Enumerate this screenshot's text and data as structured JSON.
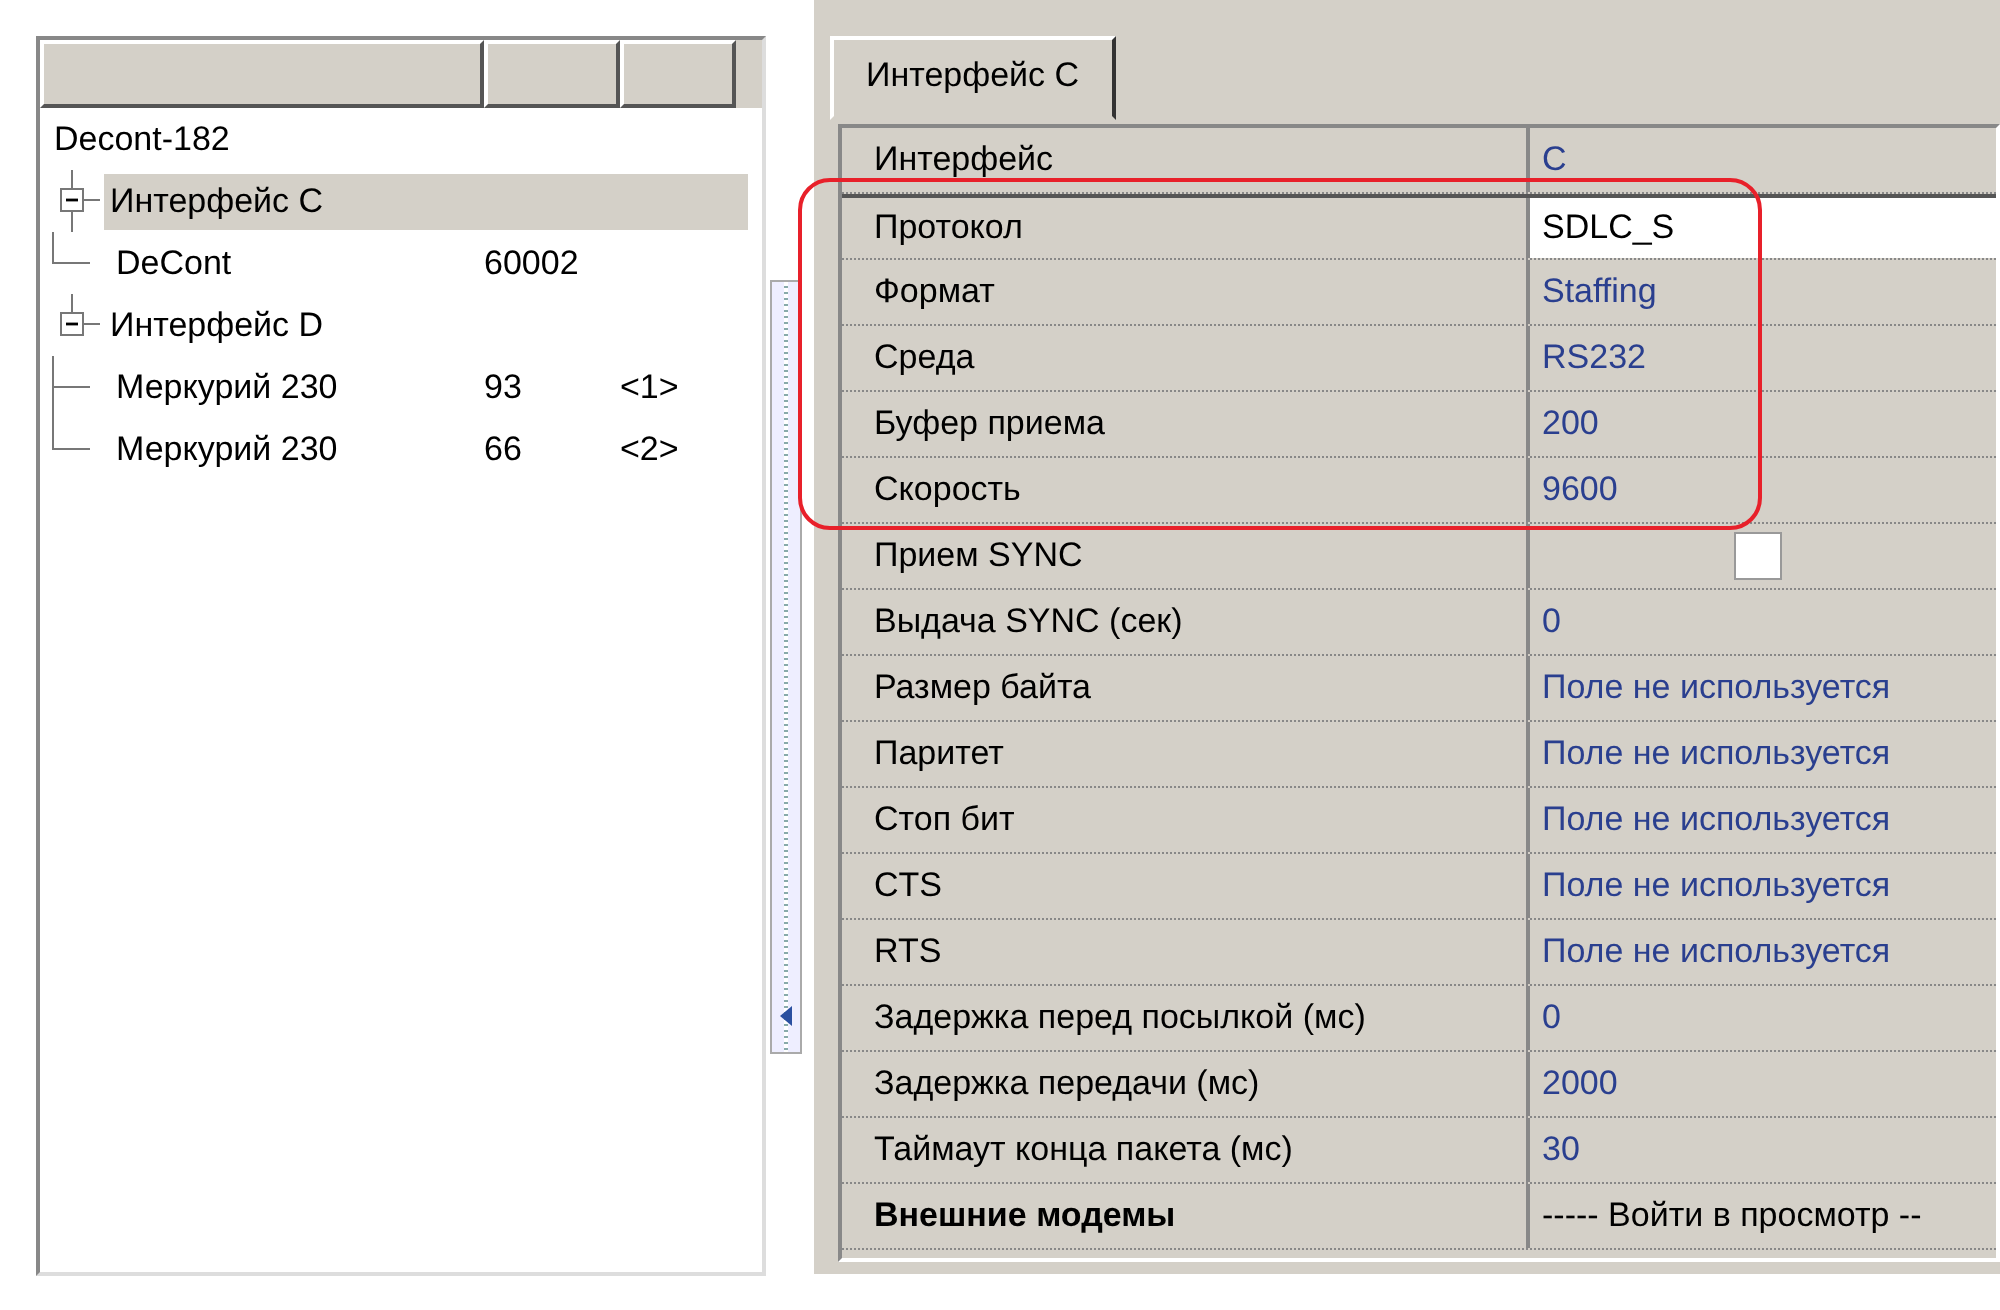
{
  "tree": {
    "root": {
      "label": "Decont-182",
      "children": [
        {
          "label": "Интерфейс C",
          "expanded": true,
          "selected": true,
          "children": [
            {
              "label": "DeCont",
              "column_2": "60002",
              "selected": false
            }
          ]
        },
        {
          "label": "Интерфейс D",
          "expanded": true,
          "selected": false,
          "children": [
            {
              "label": "Меркурий 230",
              "column_2": "93",
              "column_3": "<1>",
              "selected": false
            },
            {
              "label": "Меркурий 230",
              "column_2": "66",
              "column_3": "<2>",
              "selected": false
            }
          ]
        }
      ]
    }
  },
  "tabs": [
    {
      "label": "Интерфейс C",
      "selected": true
    }
  ],
  "properties": [
    {
      "name": "Интерфейс",
      "kind": "value",
      "value": "C",
      "selected": false
    },
    {
      "name": "Протокол",
      "kind": "value",
      "value": "SDLC_S",
      "selected": true
    },
    {
      "name": "Формат",
      "kind": "value",
      "value": "Staffing",
      "selected": false
    },
    {
      "name": "Среда",
      "kind": "value",
      "value": "RS232",
      "selected": false
    },
    {
      "name": "Буфер приема",
      "kind": "value",
      "value": "200",
      "selected": false
    },
    {
      "name": "Скорость",
      "kind": "value",
      "value": "9600",
      "selected": false
    },
    {
      "name": "Прием SYNC",
      "kind": "checkbox",
      "checked": false,
      "selected": false
    },
    {
      "name": "Выдача SYNC (сек)",
      "kind": "value",
      "value": "0",
      "selected": false
    },
    {
      "name": "Размер байта",
      "kind": "value",
      "value": "Поле не используется",
      "selected": false
    },
    {
      "name": "Паритет",
      "kind": "value",
      "value": "Поле не используется",
      "selected": false
    },
    {
      "name": "Стоп бит",
      "kind": "value",
      "value": "Поле не используется",
      "selected": false
    },
    {
      "name": "CTS",
      "kind": "value",
      "value": "Поле не используется",
      "selected": false
    },
    {
      "name": "RTS",
      "kind": "value",
      "value": "Поле не используется",
      "selected": false
    },
    {
      "name": "Задержка перед посылкой (мс)",
      "kind": "value",
      "value": "0",
      "selected": false
    },
    {
      "name": "Задержка передачи (мс)",
      "kind": "value",
      "value": "2000",
      "selected": false
    },
    {
      "name": "Таймаут конца пакета (мс)",
      "kind": "value",
      "value": "30",
      "selected": false
    },
    {
      "name": "Внешние модемы",
      "kind": "action",
      "value": "----- Войти в просмотр --",
      "selected": false
    }
  ]
}
